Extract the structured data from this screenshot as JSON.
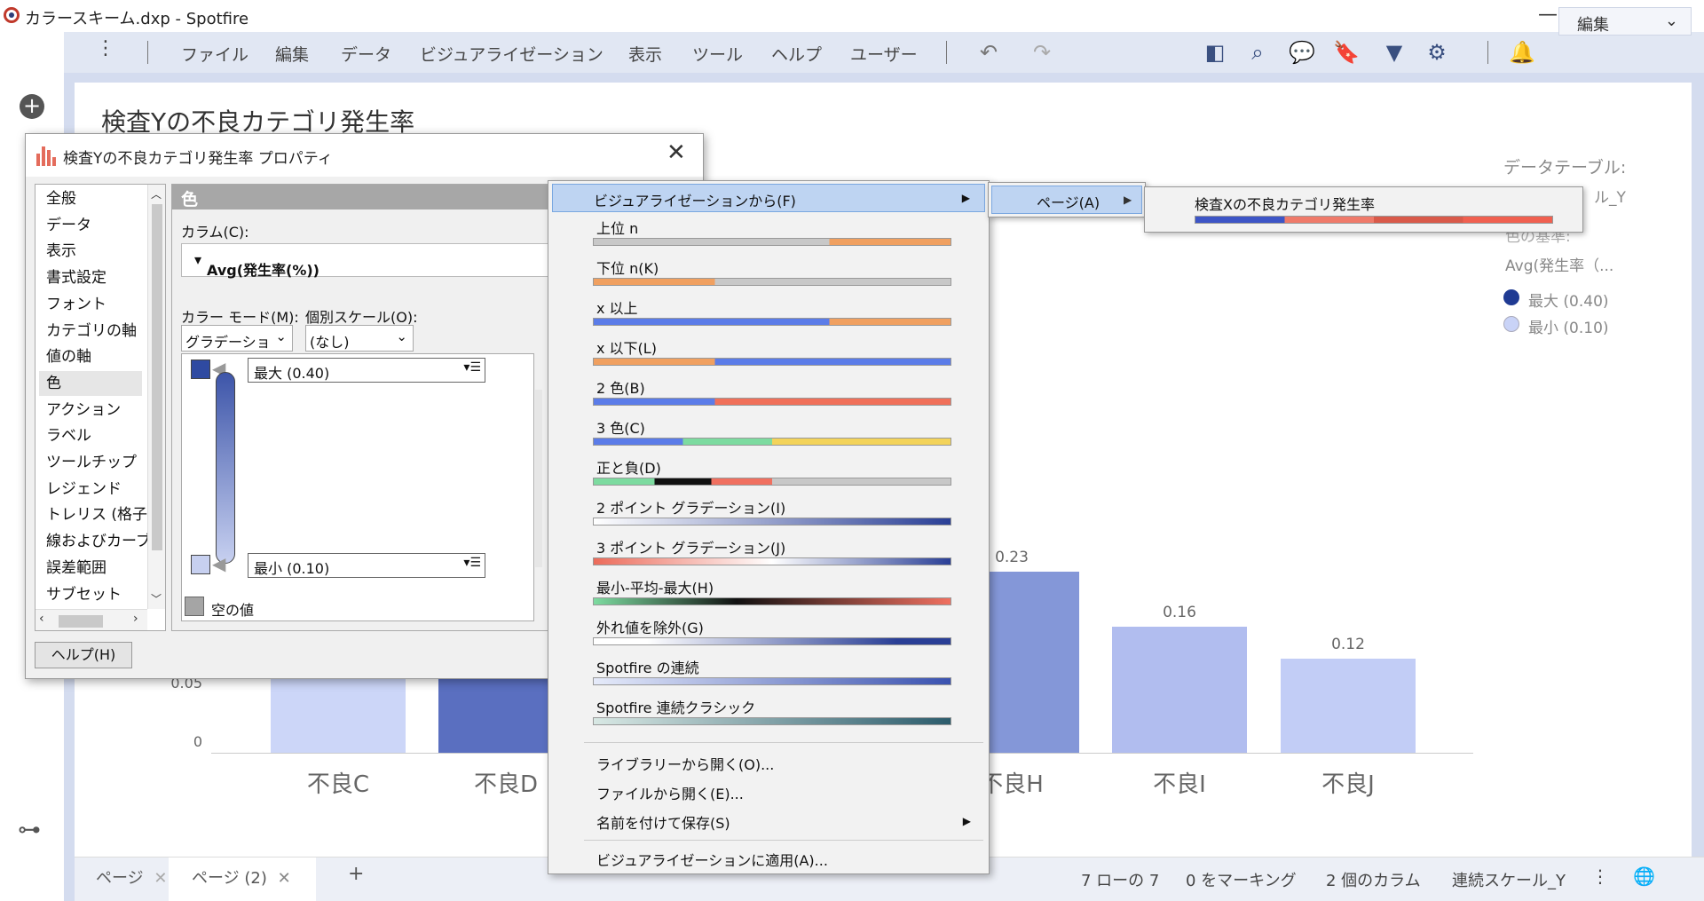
{
  "window": {
    "title": "カラースキーム.dxp - Spotfire",
    "minimize": "—",
    "restore": "❐",
    "close": "✕"
  },
  "menu": {
    "items": [
      "ファイル",
      "編集",
      "データ",
      "ビジュアライゼーション",
      "表示",
      "ツール",
      "ヘルプ",
      "ユーザー"
    ],
    "mode": "編集"
  },
  "viz": {
    "title": "検査Yの不良カテゴリ発生率",
    "legend": {
      "data_table_label": "データテーブル:",
      "data_table_value": "ル_Y",
      "color_basis_label": "色の基準:",
      "color_basis_value": "Avg(発生率（...",
      "max_label": "最大 (0.40)",
      "min_label": "最小 (0.10)",
      "max_color": "#1f3a93",
      "min_color": "#c9d3f7"
    }
  },
  "chart_data": {
    "type": "bar",
    "categories": [
      "不良C",
      "不良D",
      "不良H",
      "不良I",
      "不良J"
    ],
    "values": [
      0.1,
      0.4,
      0.23,
      0.16,
      0.12
    ],
    "data_labels": [
      "",
      "",
      "0.23",
      "0.16",
      "0.12"
    ],
    "y_ticks": [
      "0",
      "0.05"
    ],
    "ylim": [
      0,
      0.4
    ],
    "colors": [
      "#ccd6f8",
      "#5a6fc0",
      "#8497d8",
      "#b1bdef",
      "#c2cdf6"
    ]
  },
  "dialog": {
    "title": "検査Yの不良カテゴリ発生率 プロパティ",
    "nav_items": [
      "全般",
      "データ",
      "表示",
      "書式設定",
      "フォント",
      "カテゴリの軸",
      "値の軸",
      "色",
      "アクション",
      "ラベル",
      "ツールチップ",
      "レジェンド",
      "トレリス (格子)",
      "線およびカーブ",
      "誤差範囲",
      "サブセット"
    ],
    "selected_nav": "色",
    "panel_title": "色",
    "column_label": "カラム(C):",
    "column_value": "Avg(発生率(%))",
    "color_mode_label": "カラー モード(M):",
    "color_mode_value": "グラデーション",
    "individual_scale_label": "個別スケール(O):",
    "individual_scale_value": "(なし)",
    "max_value": "最大 (0.40)",
    "min_value": "最小 (0.10)",
    "max_color": "#2f4aa1",
    "min_color": "#c7d0f0",
    "empty_label": "空の値",
    "help_button": "ヘルプ(H)"
  },
  "context_menu": {
    "from_viz": "ビジュアライゼーションから(F)",
    "schemes": [
      {
        "label": "上位 n",
        "bar": "linear-gradient(to right,#c8c8c8 0%,#c8c8c8 66%,#f0a060 66%,#f0a060 100%)"
      },
      {
        "label": "下位 n(K)",
        "bar": "linear-gradient(to right,#f0a060 0%,#f0a060 34%,#c8c8c8 34%,#c8c8c8 100%)"
      },
      {
        "label": "x 以上",
        "bar": "linear-gradient(to right,#5b7ce8 0%,#5b7ce8 66%,#f0a060 66%,#f0a060 100%)"
      },
      {
        "label": "x 以下(L)",
        "bar": "linear-gradient(to right,#f0a060 0%,#f0a060 34%,#5b7ce8 34%,#5b7ce8 100%)"
      },
      {
        "label": "2 色(B)",
        "bar": "linear-gradient(to right,#5b7ce8 0%,#5b7ce8 34%,#f0705a 34%,#f0705a 100%)"
      },
      {
        "label": "3 色(C)",
        "bar": "linear-gradient(to right,#5b7ce8 0%,#5b7ce8 25%,#7ddba0 25%,#7ddba0 50%,#f3d35a 50%,#f3d35a 100%)"
      },
      {
        "label": "正と負(D)",
        "bar": "linear-gradient(to right,#7ddba0 0%,#7ddba0 17%,#111 17%,#111 33%,#f07060 33%,#f07060 50%,#c8c8c8 50%,#c8c8c8 100%)"
      },
      {
        "label": "2 ポイント グラデーション(I)",
        "bar": "linear-gradient(to right,#fff,#2a3f96)"
      },
      {
        "label": "3 ポイント グラデーション(J)",
        "bar": "linear-gradient(to right,#ec6b5a,#fff,#2a3f96)"
      },
      {
        "label": "最小-平均-最大(H)",
        "bar": "linear-gradient(to right,#7ddba0,#111 40%,#f07060)"
      },
      {
        "label": "外れ値を除外(G)",
        "bar": "linear-gradient(to right,#fff,#fff 15%,#2a3f96 85%,#2a3f96)"
      },
      {
        "label": "Spotfire の連続",
        "bar": "linear-gradient(to right,#e6ebfa,#3a52b0)"
      },
      {
        "label": "Spotfire 連続クラシック",
        "bar": "linear-gradient(to right,#d8e8e4,#2c5c6c)"
      }
    ],
    "open_library": "ライブラリーから開く(O)...",
    "open_file": "ファイルから開く(E)...",
    "save_as": "名前を付けて保存(S)",
    "apply_to_viz": "ビジュアライゼーションに適用(A)...",
    "submenu_page": "ページ(A)",
    "submenu_viz": "検査Xの不良カテゴリ発生率",
    "submenu_viz_bar": "linear-gradient(to right,#3d55c6 0%,#3d55c6 25%,#ef7a6a 25%,#ef7a6a 50%,#d95a4a 50%,#d95a4a 75%,#f06050 75%,#f06050 100%)"
  },
  "status": {
    "tabs": [
      "ページ",
      "ページ (2)"
    ],
    "add_tab": "+",
    "rows": "7 ローの 7",
    "marked": "0 をマーキング",
    "columns": "2 個のカラム",
    "table": "連続スケール_Y"
  }
}
